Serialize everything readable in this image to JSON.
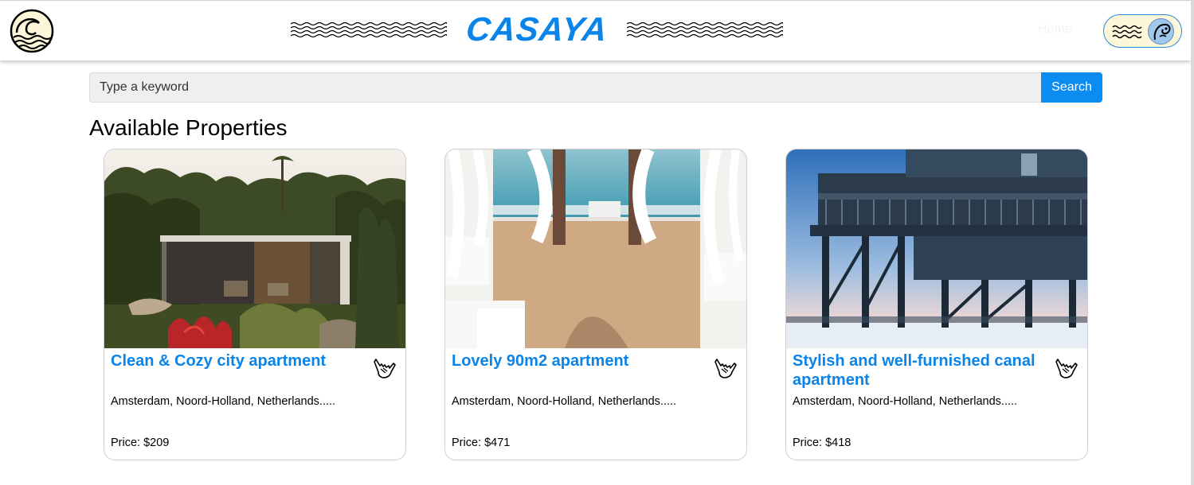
{
  "brand": {
    "name": "CASAYA",
    "color": "#0a84e8"
  },
  "nav": {
    "home_label": "Home"
  },
  "search": {
    "placeholder": "Type a keyword",
    "button_label": "Search"
  },
  "section": {
    "title": "Available Properties"
  },
  "properties": [
    {
      "title": "Clean & Cozy city apartment",
      "location": "Amsterdam, Noord-Holland, Netherlands.....",
      "price": "Price: $209",
      "image": "garden-villa-photo"
    },
    {
      "title": "Lovely 90m2 apartment",
      "location": "Amsterdam, Noord-Holland, Netherlands.....",
      "price": "Price: $471",
      "image": "beach-cabana-photo"
    },
    {
      "title": "Stylish and well-furnished canal apartment",
      "location": "Amsterdam, Noord-Holland, Netherlands.....",
      "price": "Price: $418",
      "image": "stilt-house-photo"
    }
  ],
  "icons": {
    "logo": "wave-circle-logo-icon",
    "menu": "waves-menu-icon",
    "avatar": "surfer-avatar-icon",
    "favorite": "shaka-hand-icon"
  },
  "colors": {
    "accent": "#0a84e8",
    "search_button": "#0a8cf0",
    "menu_background": "#fdf6d8"
  }
}
